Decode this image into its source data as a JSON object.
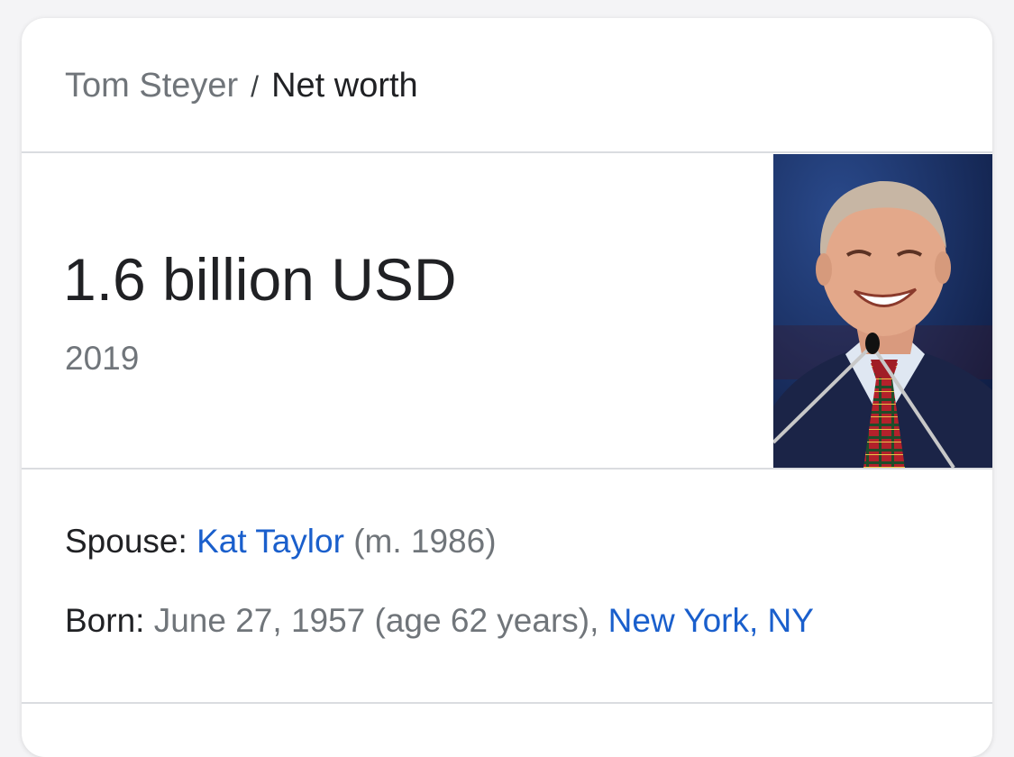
{
  "breadcrumb": {
    "parent": "Tom Steyer",
    "separator": "/",
    "current": "Net worth"
  },
  "answer": {
    "value": "1.6 billion USD",
    "year": "2019"
  },
  "photo": {
    "subject_icon": "person-photo"
  },
  "facts": {
    "spouse": {
      "label": "Spouse:",
      "name": "Kat Taylor",
      "detail": "(m. 1986)"
    },
    "born": {
      "label": "Born:",
      "date": "June 27, 1957 (age 62 years),",
      "place": "New York, NY"
    }
  },
  "colors": {
    "link": "#1a5fcc",
    "muted": "#70757a",
    "text": "#202124",
    "divider": "#dadce0"
  }
}
